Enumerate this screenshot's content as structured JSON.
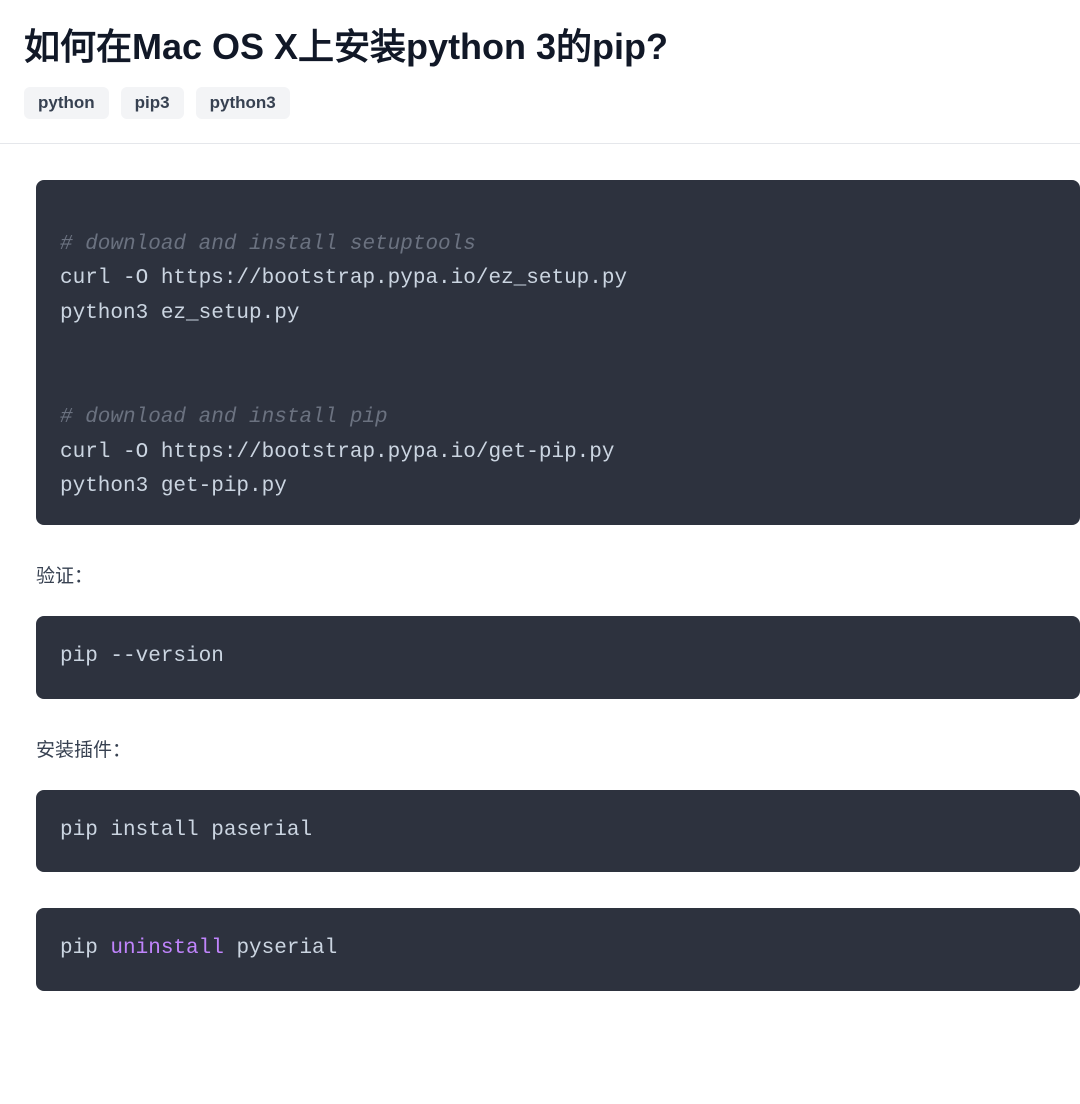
{
  "header": {
    "title": "如何在Mac OS X上安装python 3的pip?",
    "tags": [
      "python",
      "pip3",
      "python3"
    ]
  },
  "content": {
    "code_block_1": {
      "lines": [
        {
          "text": "# download and install setuptools",
          "type": "comment"
        },
        {
          "text": "curl -O https://bootstrap.pypa.io/ez_setup.py",
          "type": "code"
        },
        {
          "text": "python3 ez_setup.py",
          "type": "code"
        },
        {
          "text": "",
          "type": "blank"
        },
        {
          "text": "",
          "type": "blank"
        },
        {
          "text": "# download and install pip",
          "type": "comment"
        },
        {
          "text": "curl -O https://bootstrap.pypa.io/get-pip.py",
          "type": "code"
        },
        {
          "text": "python3 get-pip.py",
          "type": "code"
        }
      ]
    },
    "label_verify": "验证：",
    "code_block_2": {
      "text": "pip --version"
    },
    "label_install": "安装插件：",
    "code_block_3": {
      "text": "pip install paserial"
    },
    "code_block_4": {
      "prefix": "pip ",
      "keyword": "uninstall",
      "suffix": " pyserial"
    }
  }
}
